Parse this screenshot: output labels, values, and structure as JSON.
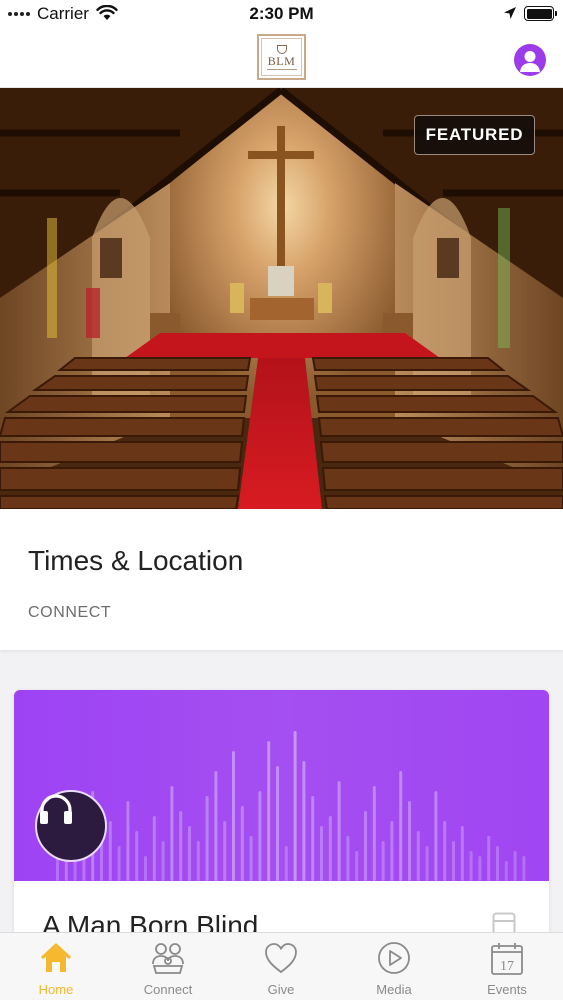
{
  "status_bar": {
    "carrier": "Carrier",
    "time": "2:30 PM",
    "battery_level": 1.0
  },
  "header": {
    "logo_text": "BLM",
    "profile_icon": "person-icon",
    "accent_color": "#9b3bea"
  },
  "featured": {
    "badge": "FEATURED",
    "image": "church-sanctuary-photo"
  },
  "times_card": {
    "title": "Times & Location",
    "tag": "CONNECT"
  },
  "media_card": {
    "title": "A Man Born Blind",
    "play_icon": "headphones-icon",
    "type_icon": "document-icon",
    "art_color": "#a046f2"
  },
  "tab_bar": {
    "active_color": "#f5b82e",
    "items": [
      {
        "label": "Home",
        "icon": "house-icon",
        "active": true
      },
      {
        "label": "Connect",
        "icon": "people-icon",
        "active": false
      },
      {
        "label": "Give",
        "icon": "heart-icon",
        "active": false
      },
      {
        "label": "Media",
        "icon": "play-circle-icon",
        "active": false
      },
      {
        "label": "Events",
        "icon": "calendar-icon",
        "active": false,
        "badge_text": "17"
      }
    ]
  }
}
